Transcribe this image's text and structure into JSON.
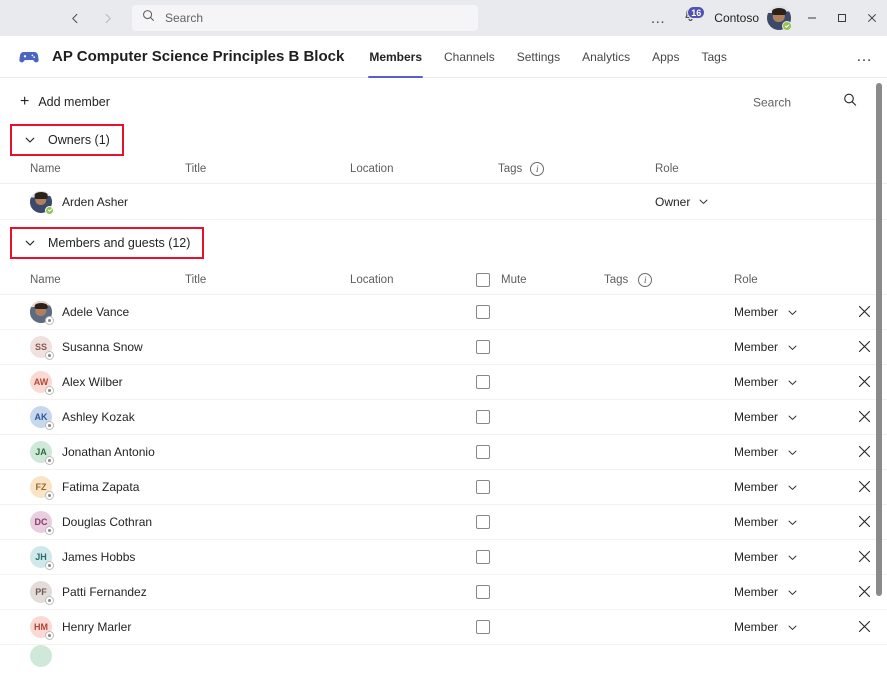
{
  "titlebar": {
    "back_icon": "chevron-left-icon",
    "forward_icon": "chevron-right-icon",
    "search_icon": "search-icon",
    "search_placeholder": "Search",
    "search_value": "",
    "more_label": "…",
    "bell_icon": "bell-icon",
    "notification_count": "16",
    "org_name": "Contoso",
    "account_presence": "available",
    "minimize_label": "–",
    "maximize_label": "▫",
    "close_label": "✕"
  },
  "team_header": {
    "icon": "game-controller-icon",
    "title": "AP Computer Science Principles B Block",
    "tabs": [
      {
        "label": "Members",
        "active": true
      },
      {
        "label": "Channels",
        "active": false
      },
      {
        "label": "Settings",
        "active": false
      },
      {
        "label": "Analytics",
        "active": false
      },
      {
        "label": "Apps",
        "active": false
      },
      {
        "label": "Tags",
        "active": false
      }
    ],
    "more_label": "…"
  },
  "toolbar": {
    "add_member_label": "Add member",
    "add_icon": "plus-icon",
    "search_placeholder": "Search",
    "search_icon": "search-icon"
  },
  "owners_section": {
    "label": "Owners (1)",
    "expanded": true,
    "annotated": true,
    "columns": [
      "Name",
      "Title",
      "Location",
      "Tags",
      "Role"
    ],
    "tags_info_icon": "info-icon",
    "rows": [
      {
        "name": "Arden Asher",
        "avatar_type": "photo",
        "initials": "AA",
        "presence": "available",
        "title": "",
        "location": "",
        "tags": "",
        "role": "Owner"
      }
    ]
  },
  "members_section": {
    "label": "Members and guests (12)",
    "expanded": true,
    "annotated": true,
    "columns": [
      "Name",
      "Title",
      "Location",
      "Mute",
      "Tags",
      "Role"
    ],
    "mute_header_checked": false,
    "tags_info_icon": "info-icon",
    "remove_icon": "close-icon",
    "rows": [
      {
        "name": "Adele Vance",
        "avatar_type": "photo",
        "initials": "AV",
        "avatar_color": "#6b4a3a",
        "text_color": "#ffffff",
        "presence": "offline",
        "title": "",
        "location": "",
        "mute": false,
        "tags": "",
        "role": "Member"
      },
      {
        "name": "Susanna Snow",
        "avatar_type": "initials",
        "initials": "SS",
        "avatar_color": "#f0e0de",
        "text_color": "#8a5a52",
        "presence": "offline",
        "title": "",
        "location": "",
        "mute": false,
        "tags": "",
        "role": "Member"
      },
      {
        "name": "Alex Wilber",
        "avatar_type": "initials",
        "initials": "AW",
        "avatar_color": "#fbdad3",
        "text_color": "#b04a3a",
        "presence": "offline",
        "title": "",
        "location": "",
        "mute": false,
        "tags": "",
        "role": "Member"
      },
      {
        "name": "Ashley Kozak",
        "avatar_type": "initials",
        "initials": "AK",
        "avatar_color": "#c7d7ee",
        "text_color": "#2b5797",
        "presence": "offline",
        "title": "",
        "location": "",
        "mute": false,
        "tags": "",
        "role": "Member"
      },
      {
        "name": "Jonathan Antonio",
        "avatar_type": "initials",
        "initials": "JA",
        "avatar_color": "#cfe8d8",
        "text_color": "#2d6a43",
        "presence": "offline",
        "title": "",
        "location": "",
        "mute": false,
        "tags": "",
        "role": "Member"
      },
      {
        "name": "Fatima Zapata",
        "avatar_type": "initials",
        "initials": "FZ",
        "avatar_color": "#fae4c8",
        "text_color": "#9a6a25",
        "presence": "offline",
        "title": "",
        "location": "",
        "mute": false,
        "tags": "",
        "role": "Member"
      },
      {
        "name": "Douglas Cothran",
        "avatar_type": "initials",
        "initials": "DC",
        "avatar_color": "#e8cfe0",
        "text_color": "#8a3a6b",
        "presence": "offline",
        "title": "",
        "location": "",
        "mute": false,
        "tags": "",
        "role": "Member"
      },
      {
        "name": "James Hobbs",
        "avatar_type": "initials",
        "initials": "JH",
        "avatar_color": "#cfe9ea",
        "text_color": "#2b6b72",
        "presence": "offline",
        "title": "",
        "location": "",
        "mute": false,
        "tags": "",
        "role": "Member"
      },
      {
        "name": "Patti Fernandez",
        "avatar_type": "initials",
        "initials": "PF",
        "avatar_color": "#e3dcd8",
        "text_color": "#6b5a52",
        "presence": "offline",
        "title": "",
        "location": "",
        "mute": false,
        "tags": "",
        "role": "Member"
      },
      {
        "name": "Henry Marler",
        "avatar_type": "initials",
        "initials": "HM",
        "avatar_color": "#fbd9d2",
        "text_color": "#b0453a",
        "presence": "offline",
        "title": "",
        "location": "",
        "mute": false,
        "tags": "",
        "role": "Member"
      }
    ]
  },
  "scrollbar": {
    "visible": true
  },
  "colors": {
    "accent": "#5b5fc7",
    "badge": "#4f52b2",
    "annotation": "#e8112d",
    "presence_available": "#92c353",
    "titlebar_bg": "#e9eaee"
  }
}
